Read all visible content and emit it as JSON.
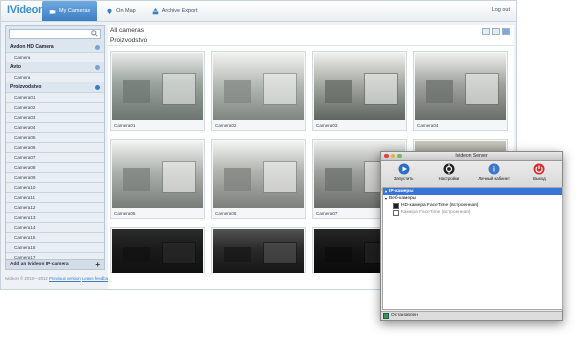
{
  "app": {
    "logo_text": "IVideon",
    "nav": [
      {
        "label": "My Cameras",
        "icon": "camera-icon",
        "active": true
      },
      {
        "label": "On Map",
        "icon": "map-pin-icon",
        "active": false
      },
      {
        "label": "Archive Export",
        "icon": "export-icon",
        "active": false
      }
    ],
    "logout_label": "Log out"
  },
  "sidebar": {
    "search_placeholder": "",
    "groups": [
      {
        "label": "Avdon HD Camera",
        "items": [
          "Camera"
        ]
      },
      {
        "label": "Avto",
        "items": [
          "Camera"
        ]
      },
      {
        "label": "Proizvodstvo",
        "items": [
          "Camera01",
          "Camera02",
          "Camera03",
          "Camera04",
          "Camera05",
          "Camera06",
          "Camera07",
          "Camera08",
          "Camera09",
          "Camera10",
          "Camera11",
          "Camera12",
          "Camera13",
          "Camera14",
          "Camera15",
          "Camera16",
          "Camera17"
        ]
      }
    ],
    "add_label": "Add an Ivideon IP-camera"
  },
  "footer": {
    "copyright": "Ivideon © 2010—2012",
    "link1": "Previous version",
    "link2": "Leave feedback"
  },
  "main": {
    "title": "All cameras",
    "subtitle": "Proizvodstvo",
    "tiles": [
      {
        "caption": "Camera01"
      },
      {
        "caption": "Camera02"
      },
      {
        "caption": "Camera03"
      },
      {
        "caption": "Camera04"
      },
      {
        "caption": "Camera05"
      },
      {
        "caption": "Camera06"
      },
      {
        "caption": "Camera07"
      },
      {
        "caption": ""
      },
      {
        "caption": ""
      },
      {
        "caption": ""
      },
      {
        "caption": ""
      }
    ]
  },
  "server_dialog": {
    "title": "Ivideon Server",
    "toolbar": [
      {
        "label": "Запустить",
        "icon": "play-icon"
      },
      {
        "label": "Настройки",
        "icon": "settings-icon"
      },
      {
        "label": "Личный кабинет",
        "icon": "cabinet-icon"
      },
      {
        "label": "Выход",
        "icon": "power-icon"
      }
    ],
    "tree": [
      {
        "label": "IP-камеры",
        "level": 1,
        "selected": true
      },
      {
        "label": "Веб-камеры",
        "level": 1,
        "selected": false
      },
      {
        "label": "HD-камера FaceTime (встроенная)",
        "level": 2,
        "checked": true
      },
      {
        "label": "Камера FaceTime (встроенная)",
        "level": 2,
        "checked": false
      }
    ],
    "status": "Остановлен"
  }
}
